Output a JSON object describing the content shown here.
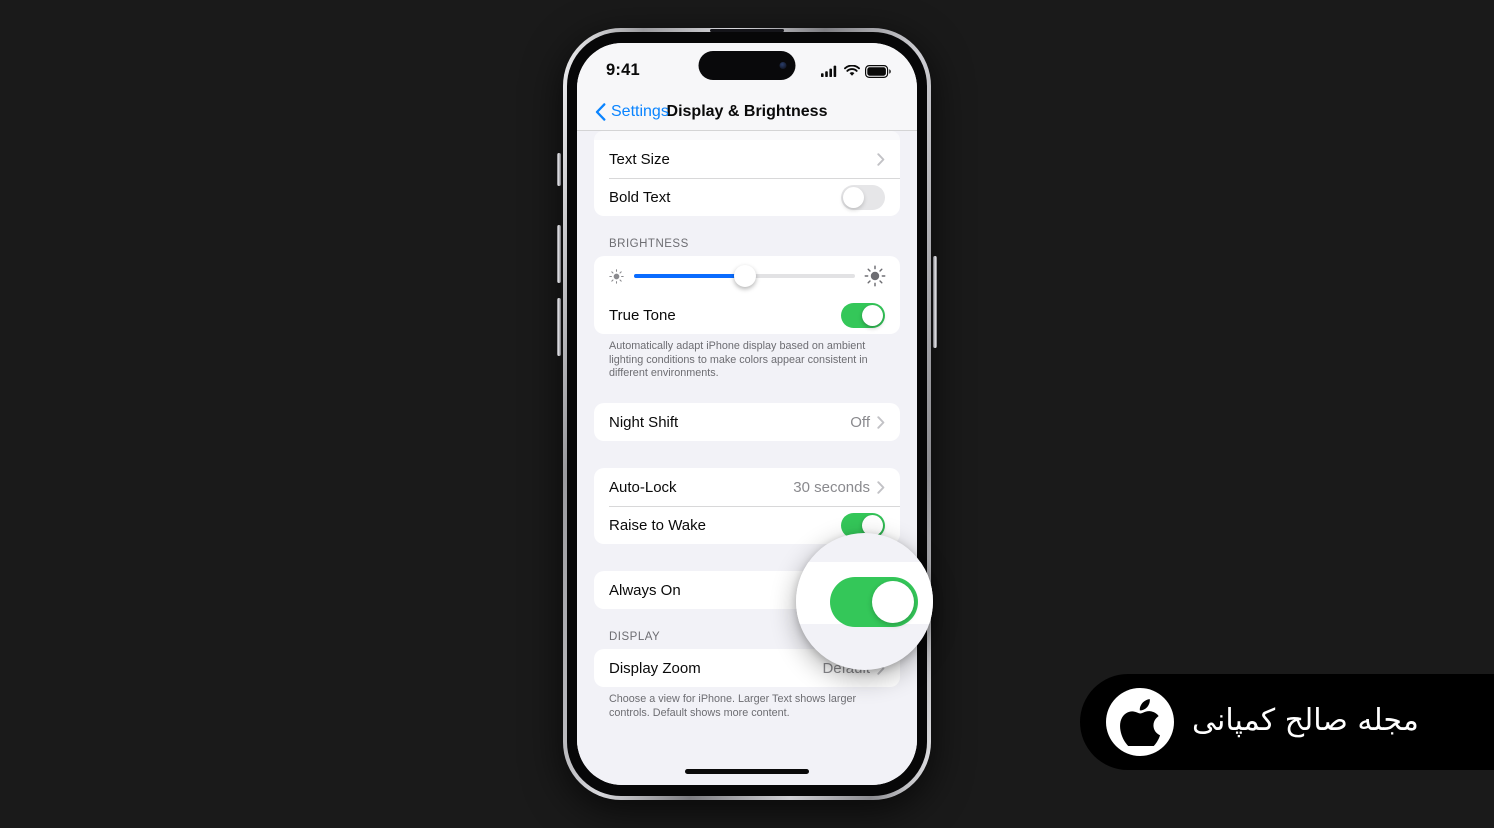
{
  "background_color": "#1a1a1a",
  "device": {
    "name": "iphone-15-pro",
    "buttons": [
      "action-button",
      "volume-up-button",
      "volume-down-button",
      "power-button"
    ]
  },
  "status_bar": {
    "time": "9:41",
    "icons": [
      "cellular-signal-icon",
      "wifi-icon",
      "battery-icon"
    ],
    "dynamic_island": "dynamic-island"
  },
  "nav_bar": {
    "back_label": "Settings",
    "title": "Display & Brightness",
    "back_icon": "chevron-left-icon",
    "tint_color": "#0a84ff"
  },
  "colors": {
    "green_on": "#34c759",
    "toggle_off": "#e6e6e8",
    "slider_fill": "#0a6cff",
    "group_background": "#ffffff",
    "page_background": "#f2f2f7"
  },
  "sections": [
    {
      "header": "",
      "rows": [
        {
          "label": "Text Size",
          "value": "",
          "control": "chevron"
        },
        {
          "label": "Bold Text",
          "value": "",
          "control": "toggle-off"
        }
      ],
      "footnote": ""
    },
    {
      "header": "BRIGHTNESS",
      "slider": {
        "name": "brightness-slider",
        "value_percent": 50,
        "min_icon": "sun-small-icon",
        "max_icon": "sun-large-icon"
      },
      "rows": [
        {
          "label": "True Tone",
          "value": "",
          "control": "toggle-on"
        }
      ],
      "footnote": "Automatically adapt iPhone display based on ambient lighting conditions to make colors appear consistent in different environments."
    },
    {
      "header": "",
      "rows": [
        {
          "label": "Night Shift",
          "value": "Off",
          "control": "chevron"
        }
      ],
      "footnote": ""
    },
    {
      "header": "",
      "rows": [
        {
          "label": "Auto-Lock",
          "value": "30 seconds",
          "control": "chevron"
        },
        {
          "label": "Raise to Wake",
          "value": "",
          "control": "toggle-on"
        }
      ],
      "footnote": ""
    },
    {
      "header": "",
      "rows": [
        {
          "label": "Always On",
          "value": "",
          "control": "toggle-on"
        }
      ],
      "footnote": ""
    },
    {
      "header": "DISPLAY",
      "rows": [
        {
          "label": "Display Zoom",
          "value": "Default",
          "control": "chevron"
        }
      ],
      "footnote": "Choose a view for iPhone. Larger Text shows larger controls. Default shows more content."
    }
  ],
  "magnifier": {
    "name": "magnifier-callout",
    "highlights": "always-on-toggle",
    "state": "on"
  },
  "watermark": {
    "text": "مجله صالح کمپانی",
    "logo": "apple-logo-icon"
  }
}
